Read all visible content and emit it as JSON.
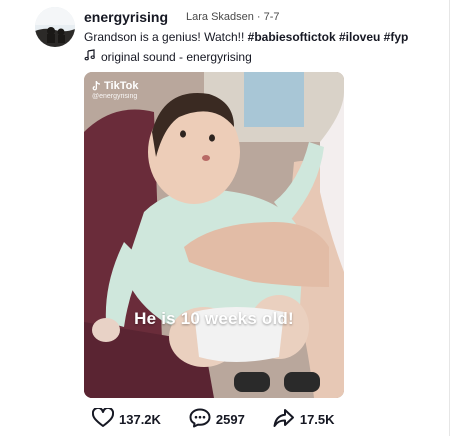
{
  "post": {
    "username": "energyrising",
    "meta": "Lara Skadsen · 7-7",
    "caption_text": "Grandson is a genius! Watch!! ",
    "caption_tags": "#babiesoftictok #iloveu #fyp",
    "sound": "original sound - energyrising"
  },
  "video": {
    "watermark_brand": "TikTok",
    "watermark_handle": "@energyrising",
    "subtitle": "He is 10 weeks old!"
  },
  "actions": {
    "likes": "137.2K",
    "comments": "2597",
    "shares": "17.5K"
  },
  "icons": [
    "music-note-icon",
    "tiktok-logo-icon",
    "heart-icon",
    "comment-icon",
    "share-icon"
  ]
}
